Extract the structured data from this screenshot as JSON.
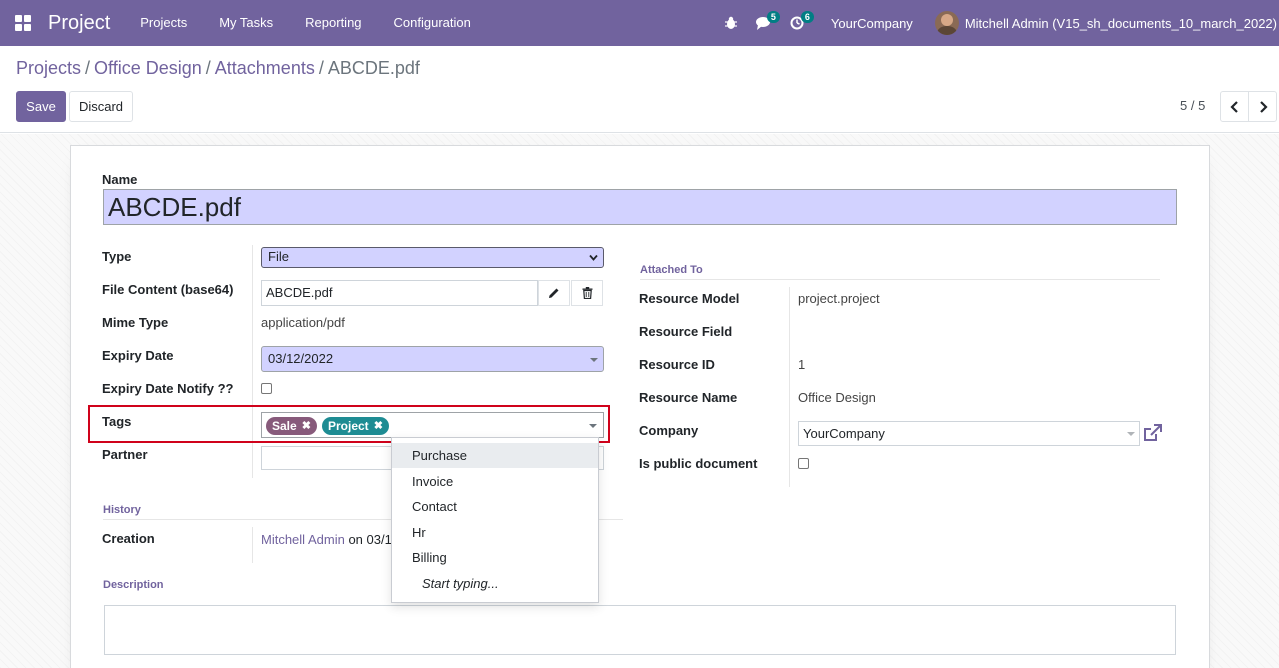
{
  "navbar": {
    "app_title": "Project",
    "menu": [
      "Projects",
      "My Tasks",
      "Reporting",
      "Configuration"
    ],
    "messages_count": "5",
    "activities_count": "6",
    "company": "YourCompany",
    "user": "Mitchell Admin (V15_sh_documents_10_march_2022)"
  },
  "breadcrumb": {
    "items": [
      "Projects",
      "Office Design",
      "Attachments"
    ],
    "separator": "/",
    "current": "ABCDE.pdf"
  },
  "actions": {
    "save": "Save",
    "discard": "Discard"
  },
  "pager": {
    "value": "5 / 5"
  },
  "form": {
    "name_label": "Name",
    "name_value": "ABCDE.pdf",
    "type": {
      "label": "Type",
      "value": "File"
    },
    "file_content": {
      "label": "File Content (base64)",
      "value": "ABCDE.pdf"
    },
    "mime_type": {
      "label": "Mime Type",
      "value": "application/pdf"
    },
    "expiry_date": {
      "label": "Expiry Date",
      "value": "03/12/2022"
    },
    "expiry_notify": {
      "label": "Expiry Date Notify ??",
      "checked": false
    },
    "tags": {
      "label": "Tags",
      "selected": [
        {
          "name": "Sale",
          "color": "#875a7b"
        },
        {
          "name": "Project",
          "color": "#1e8c93"
        }
      ],
      "dropdown_options": [
        "Purchase",
        "Invoice",
        "Contact",
        "Hr",
        "Billing"
      ],
      "dropdown_hint": "Start typing..."
    },
    "partner": {
      "label": "Partner",
      "value": ""
    },
    "history": {
      "title": "History",
      "creation_label": "Creation",
      "creation_user": "Mitchell Admin",
      "creation_suffix": "on 03/1"
    },
    "description_title": "Description",
    "attached_to": {
      "title": "Attached To",
      "resource_model": {
        "label": "Resource Model",
        "value": "project.project"
      },
      "resource_field": {
        "label": "Resource Field",
        "value": ""
      },
      "resource_id": {
        "label": "Resource ID",
        "value": "1"
      },
      "resource_name": {
        "label": "Resource Name",
        "value": "Office Design"
      },
      "company": {
        "label": "Company",
        "value": "YourCompany"
      },
      "is_public": {
        "label": "Is public document",
        "checked": false
      }
    }
  },
  "colors": {
    "brand": "#71639e",
    "highlight_border": "#d0021b",
    "input_required_bg": "#d2d2ff",
    "badge": "#017e84"
  },
  "icons": [
    "apps-grid-icon",
    "bug-icon",
    "chat-icon",
    "clock-icon",
    "pencil-icon",
    "trash-icon",
    "external-link-icon",
    "chevron-left-icon",
    "chevron-right-icon"
  ]
}
